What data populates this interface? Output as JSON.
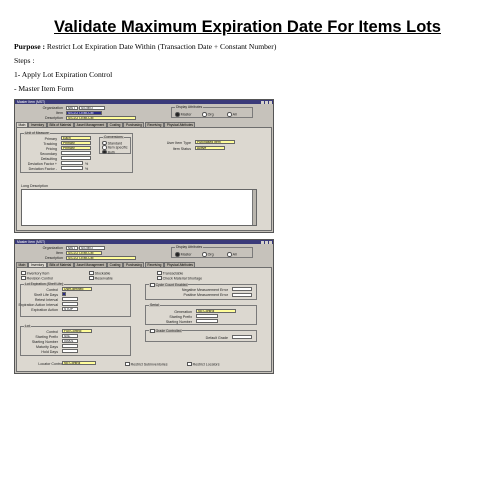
{
  "doc": {
    "title": "Validate Maximum Expiration Date For Items Lots",
    "purpose_label": "Purpose :",
    "purpose_text": "Restrict Lot Expiration  Date Within (Transaction Date + Constant  Number)",
    "steps_label": "Steps :",
    "step1": "1- Apply Lot Expiration  Control",
    "step1_sub": " - Master Item Form"
  },
  "screen1": {
    "window_title": "Master Item (MST)",
    "org_label": "Organization",
    "org_code": "MST",
    "org_name": "SS MST",
    "item_label": "Item",
    "item_value": "SS-LOT-Exp-CM",
    "desc_label": "Description",
    "desc_value": "SS-LOT-Exp-CM",
    "display_group": "Display Attributes",
    "display_opts": [
      "Master",
      "Org",
      "All"
    ],
    "tabs": [
      "Main",
      "Inventory",
      "Bills of Material",
      "Asset Management",
      "Costing",
      "Purchasing",
      "Receiving",
      "Physical Attributes"
    ],
    "uom_group": "Unit of Measure",
    "uom_rows": [
      {
        "label": "Primary",
        "value": "Each"
      },
      {
        "label": "Tracking",
        "value": "Primary"
      },
      {
        "label": "Pricing",
        "value": "Primary"
      },
      {
        "label": "Secondary",
        "value": ""
      },
      {
        "label": "Defaulting",
        "value": ""
      },
      {
        "label": "Deviation Factor +",
        "value": ""
      },
      {
        "label": "Deviation Factor -",
        "value": ""
      }
    ],
    "pct": "%",
    "conversions_group": "Conversions",
    "conversions_opts": [
      "Standard",
      "Item specific",
      "Both"
    ],
    "user_item_type_label": "User Item Type",
    "user_item_type_value": "Purchased Item",
    "item_status_label": "Item Status",
    "item_status_value": "Active",
    "long_desc_label": "Long Description"
  },
  "screen2": {
    "window_title": "Master Item (MST)",
    "org_label": "Organization",
    "org_code": "MST",
    "org_name": "SS MST",
    "item_label": "Item",
    "item_value": "SS-LOT-Exp-CM",
    "desc_label": "Description",
    "desc_value": "SS-LOT-Exp-CM",
    "display_group": "Display Attributes",
    "display_opts": [
      "Master",
      "Org",
      "All"
    ],
    "tabs": [
      "Main",
      "Inventory",
      "Bills of Material",
      "Asset Management",
      "Costing",
      "Purchasing",
      "Receiving",
      "Physical Attributes"
    ],
    "checks_left": [
      "Inventory Item",
      "Stockable",
      "Transactable"
    ],
    "checks_left2": [
      "Revision Control",
      "Reservable",
      "Check Material Shortage"
    ],
    "lot_exp_group": "Lot Expiration (Shelf Life)",
    "control_label": "Control",
    "control_value": "User-defined",
    "shelf_days_label": "Shelf Life Days",
    "retest_label": "Retest Interval",
    "exp_action_interval_label": "Expiration Action Interval",
    "exp_action_label": "Expiration Action",
    "exp_action_value": "STOP",
    "cycle_group": "Cycle Count Enabled",
    "neg_label": "Negative Measurement Error",
    "pos_label": "Positive Measurement Error",
    "serial_group": "Serial",
    "generation_label": "Generation",
    "generation_value": "No Control",
    "serial_prefix_label": "Starting Prefix",
    "serial_number_label": "Starting Number",
    "lot_group": "Lot",
    "lot_control_label": "Control",
    "lot_control_value": "Full Control",
    "lot_prefix_label": "Starting Prefix",
    "lot_prefix_value": "SSL",
    "lot_number_label": "Starting Number",
    "lot_number_value": "00001",
    "maturity_label": "Maturity Days",
    "hold_label": "Hold Days",
    "grade_label": "Grade Controlled",
    "default_grade_label": "Default Grade",
    "locator_label": "Locator Control",
    "locator_value": "No Control",
    "restrict_sub_label": "Restrict Subinventories",
    "restrict_loc_label": "Restrict Locators"
  },
  "colors": {
    "window_bg": "#c6c2bb",
    "titlebar": "#3a3a7a",
    "required_field": "#fffd9a",
    "selected_field": "#2b2b8a"
  }
}
